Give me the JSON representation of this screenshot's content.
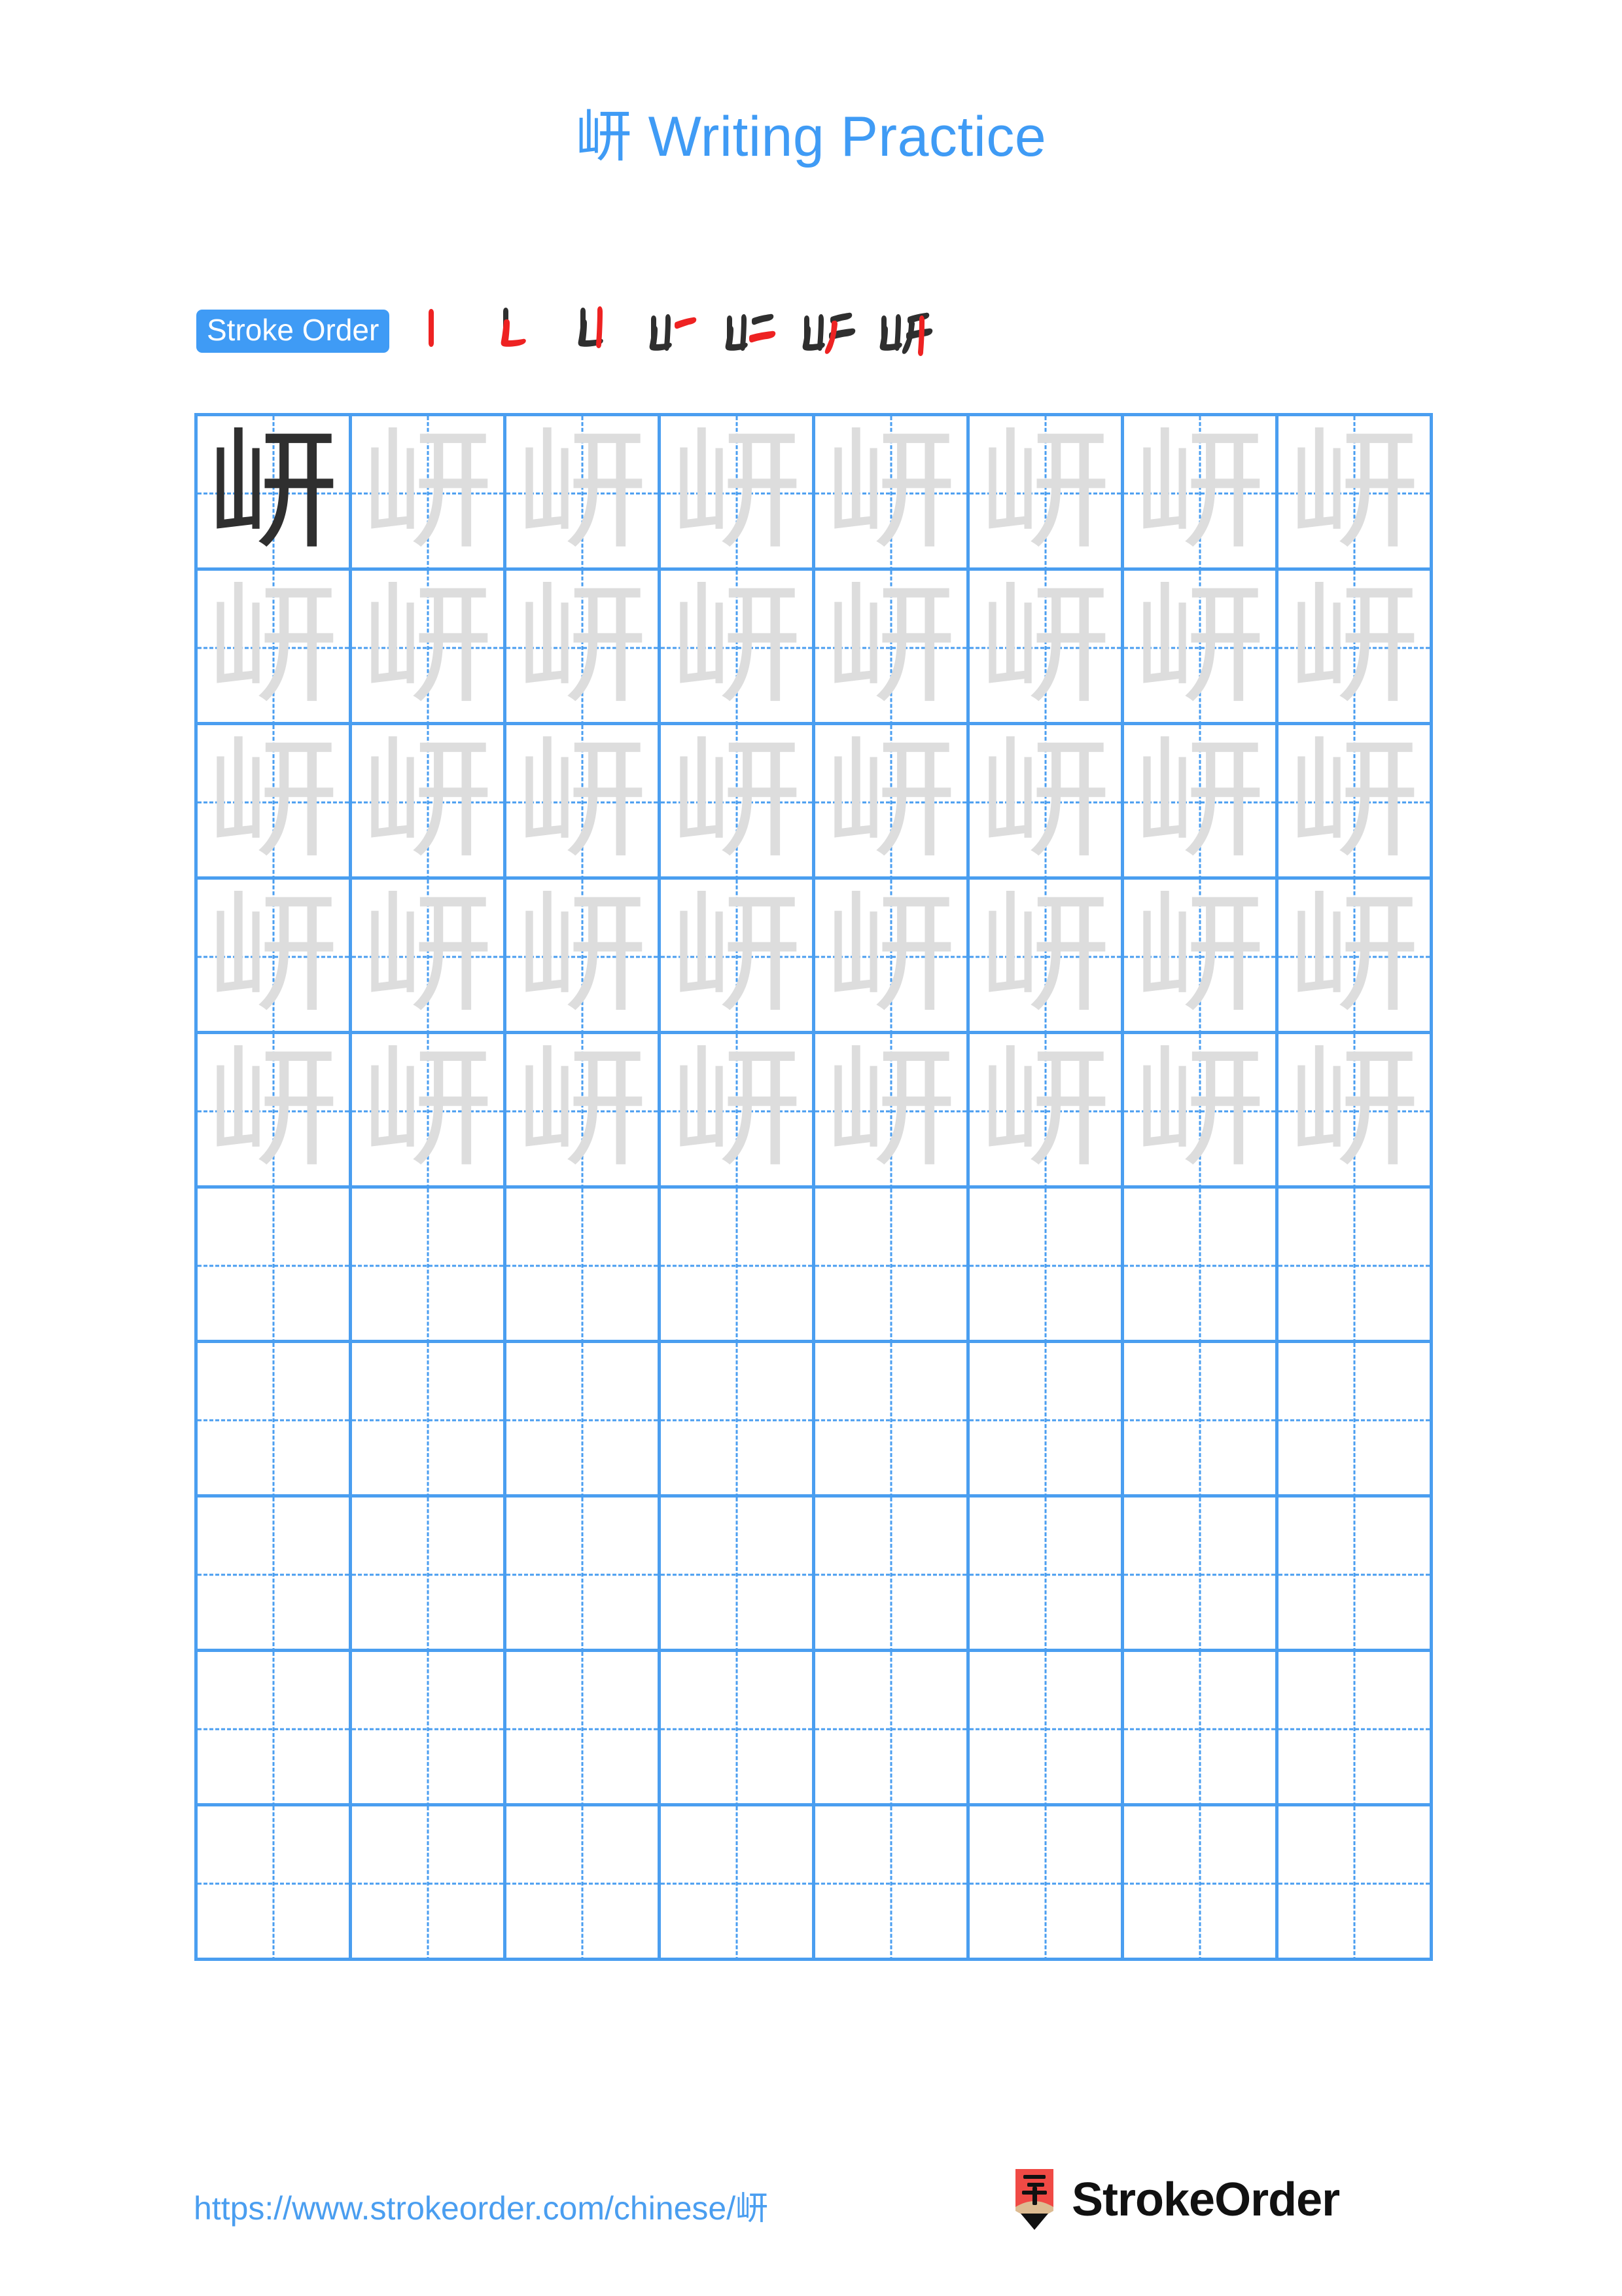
{
  "character": "岍",
  "title": "岍 Writing Practice",
  "colors": {
    "accent_blue": "#3f9bf5",
    "grid_blue": "#4a9ef0",
    "trace_gray": "#dddddd",
    "model_dark": "#2f2f2f",
    "logo_red": "#f04a45",
    "logo_wood": "#ddbb91",
    "logo_black": "#111111"
  },
  "stroke_order": {
    "badge_label": "Stroke Order",
    "steps": [
      {
        "index": 1,
        "glyph": "丨",
        "new_stroke": "vertical"
      },
      {
        "index": 2,
        "glyph": "⺍",
        "new_stroke": "vertical-hook-left"
      },
      {
        "index": 3,
        "glyph": "山",
        "new_stroke": "vertical-right"
      },
      {
        "index": 4,
        "glyph": "山一",
        "new_stroke": "horizontal-upper"
      },
      {
        "index": 5,
        "glyph": "山二",
        "new_stroke": "horizontal-lower"
      },
      {
        "index": 6,
        "glyph": "山厂",
        "new_stroke": "left-falling"
      },
      {
        "index": 7,
        "glyph": "岍",
        "new_stroke": "vertical-final"
      }
    ],
    "total_strokes": 7
  },
  "practice_grid": {
    "columns": 8,
    "rows": 10,
    "filled_rows": 5,
    "empty_rows": 5,
    "cells": [
      [
        "岍",
        "岍",
        "岍",
        "岍",
        "岍",
        "岍",
        "岍",
        "岍"
      ],
      [
        "岍",
        "岍",
        "岍",
        "岍",
        "岍",
        "岍",
        "岍",
        "岍"
      ],
      [
        "岍",
        "岍",
        "岍",
        "岍",
        "岍",
        "岍",
        "岍",
        "岍"
      ],
      [
        "岍",
        "岍",
        "岍",
        "岍",
        "岍",
        "岍",
        "岍",
        "岍"
      ],
      [
        "岍",
        "岍",
        "岍",
        "岍",
        "岍",
        "岍",
        "岍",
        "岍"
      ],
      [
        "",
        "",
        "",
        "",
        "",
        "",
        "",
        ""
      ],
      [
        "",
        "",
        "",
        "",
        "",
        "",
        "",
        ""
      ],
      [
        "",
        "",
        "",
        "",
        "",
        "",
        "",
        ""
      ],
      [
        "",
        "",
        "",
        "",
        "",
        "",
        "",
        ""
      ],
      [
        "",
        "",
        "",
        "",
        "",
        "",
        "",
        ""
      ]
    ],
    "model_cell": {
      "row": 0,
      "column": 0
    }
  },
  "footer": {
    "url": "https://www.strokeorder.com/chinese/岍",
    "brand_name": "StrokeOrder",
    "logo_character": "字"
  }
}
